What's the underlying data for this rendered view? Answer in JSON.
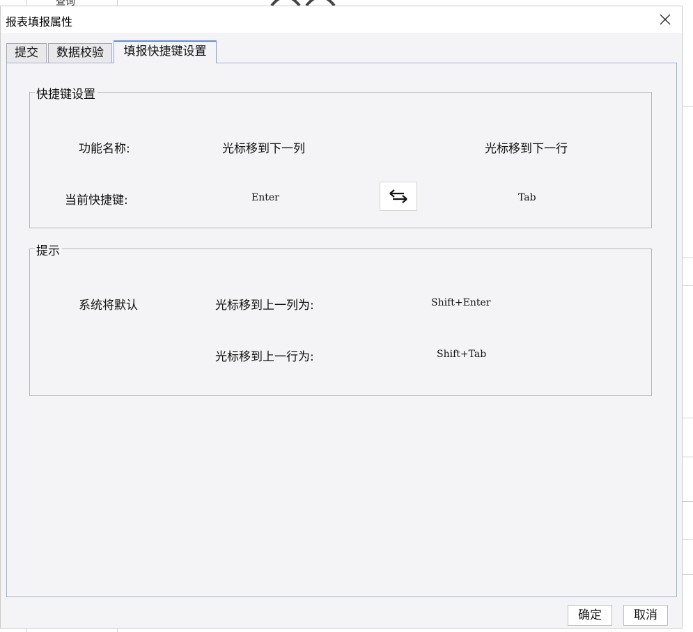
{
  "background": {
    "cell_text": "查询"
  },
  "dialog": {
    "title": "报表填报属性",
    "close_icon": "close-icon"
  },
  "tabs": [
    {
      "label": "提交",
      "active": false
    },
    {
      "label": "数据校验",
      "active": false
    },
    {
      "label": "填报快捷键设置",
      "active": true
    }
  ],
  "shortcut_group": {
    "legend": "快捷键设置",
    "function_name_label": "功能名称:",
    "current_shortcut_label": "当前快捷键:",
    "func_left": "光标移到下一列",
    "func_right": "光标移到下一行",
    "key_left": "Enter",
    "key_right": "Tab",
    "swap_icon": "swap-arrows-icon"
  },
  "hint_group": {
    "legend": "提示",
    "system_default": "系统将默认",
    "prev_col_label": "光标移到上一列为:",
    "prev_col_key": "Shift+Enter",
    "prev_row_label": "光标移到上一行为:",
    "prev_row_key": "Shift+Tab"
  },
  "footer": {
    "ok_label": "确定",
    "cancel_label": "取消"
  }
}
